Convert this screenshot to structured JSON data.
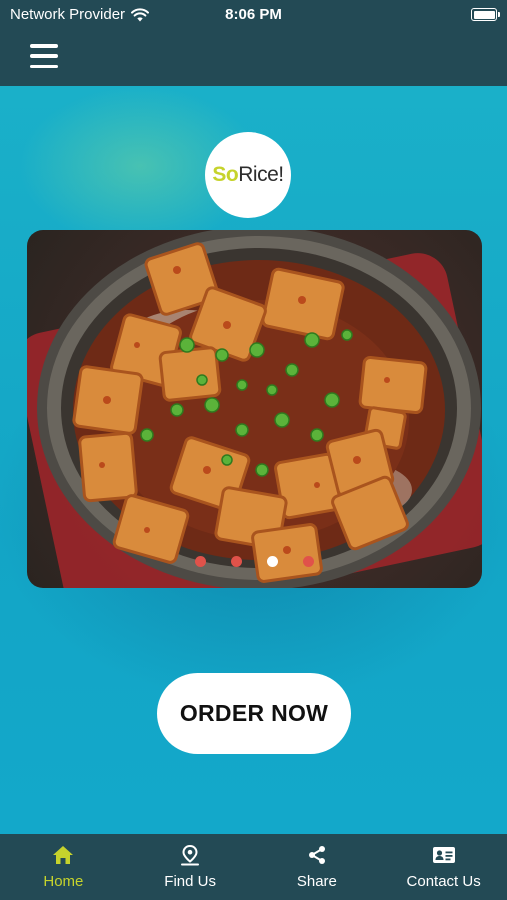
{
  "status_bar": {
    "carrier": "Network Provider",
    "time": "8:06 PM",
    "wifi_icon": "wifi-icon",
    "battery_icon": "battery-icon"
  },
  "nav": {
    "menu_icon": "hamburger-menu-icon"
  },
  "logo": {
    "part1": "So",
    "part2": "Rice!",
    "accent_color": "#c6d32c"
  },
  "slider": {
    "image": "mapo tofu rice bowl photo",
    "slide_count": 4,
    "active_index": 2
  },
  "order_button": {
    "label": "ORDER NOW"
  },
  "tabs": [
    {
      "label": "Home",
      "icon": "home-icon",
      "active": true
    },
    {
      "label": "Find Us",
      "icon": "location-pin-icon",
      "active": false
    },
    {
      "label": "Share",
      "icon": "share-icon",
      "active": false
    },
    {
      "label": "Contact Us",
      "icon": "contact-card-icon",
      "active": false
    }
  ],
  "colors": {
    "bar_background": "#234a55",
    "main_background": "#1aa9c7",
    "active_tab": "#c6d32c",
    "dot": "#e0524a"
  }
}
